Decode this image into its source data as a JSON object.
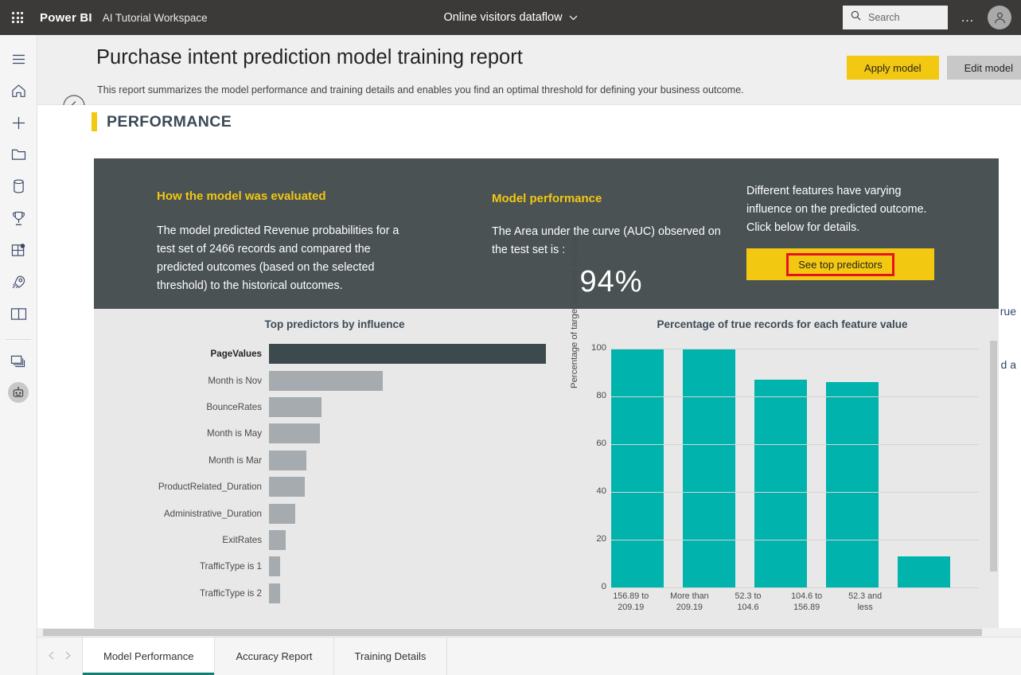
{
  "topbar": {
    "waffle_icon": "waffle-grid-icon",
    "brand": "Power BI",
    "workspace": "AI Tutorial Workspace",
    "document_title": "Online visitors dataflow",
    "caret_icon": "chevron-down-icon",
    "search_placeholder": "Search",
    "search_value": "",
    "search_icon": "search-icon",
    "more_icon": "ellipsis-icon",
    "avatar_icon": "user-avatar-icon"
  },
  "leftnav": {
    "items": [
      {
        "name": "hamburger-menu",
        "icon": "hamburger-icon"
      },
      {
        "name": "home",
        "icon": "home-icon"
      },
      {
        "name": "create",
        "icon": "plus-icon"
      },
      {
        "name": "browse",
        "icon": "folder-icon"
      },
      {
        "name": "data-hub",
        "icon": "database-icon"
      },
      {
        "name": "goals",
        "icon": "trophy-icon"
      },
      {
        "name": "apps",
        "icon": "apps-grid-icon"
      },
      {
        "name": "deployment-pipelines",
        "icon": "rocket-icon"
      },
      {
        "name": "learn",
        "icon": "book-icon"
      },
      {
        "name": "workspaces",
        "icon": "workspaces-icon"
      },
      {
        "name": "current-workspace",
        "icon": "robot-icon"
      }
    ]
  },
  "report_header": {
    "back_icon": "back-arrow-icon",
    "title": "Purchase intent prediction model training report",
    "subtitle": "This report summarizes the model performance and training details and enables you find an optimal threshold for defining your business outcome.",
    "apply_label": "Apply model",
    "edit_label": "Edit model"
  },
  "section": {
    "heading": "PERFORMANCE",
    "accent_color": "#f2c811"
  },
  "summary_panel": {
    "background": "#4a5254",
    "col1": {
      "heading": "How the model was evaluated",
      "body": "The model predicted Revenue probabilities for a test set of 2466 records and compared the predicted outcomes (based on the selected threshold) to the historical outcomes."
    },
    "col2": {
      "heading": "Model performance",
      "body": "The Area under the curve (AUC) observed on the test set is :",
      "auc_value": "94%"
    },
    "col3": {
      "body": "Different features have varying influence on the predicted outcome.  Click below for details.",
      "button_label": "See top predictors",
      "button_color": "#f2c811",
      "highlight_color": "#e81123"
    }
  },
  "chart_data": [
    {
      "type": "bar",
      "orientation": "horizontal",
      "title": "Top predictors by influence",
      "xlabel": "",
      "ylabel": "",
      "grid": false,
      "categories": [
        "PageValues",
        "Month is Nov",
        "BounceRates",
        "Month is May",
        "Month is Mar",
        "ProductRelated_Duration",
        "Administrative_Duration",
        "ExitRates",
        "TrafficType is 1",
        "TrafficType is 2"
      ],
      "values": [
        100,
        41,
        19,
        18.5,
        13.5,
        13,
        9.5,
        6,
        4,
        4
      ],
      "bar_colors": [
        "#3c4a4d",
        "#a5abaf",
        "#a5abaf",
        "#a5abaf",
        "#a5abaf",
        "#a5abaf",
        "#a5abaf",
        "#a5abaf",
        "#a5abaf",
        "#a5abaf"
      ],
      "highlighted_category": "PageValues"
    },
    {
      "type": "bar",
      "orientation": "vertical",
      "title": "Percentage of true records for each feature value",
      "xlabel": "",
      "ylabel": "Percentage of target outcome records",
      "grid": true,
      "legend": "none",
      "ylim": [
        0,
        100
      ],
      "yticks": [
        0,
        20,
        40,
        60,
        80,
        100
      ],
      "categories": [
        "156.89 to 209.19",
        "More than 209.19",
        "52.3 to 104.6",
        "104.6 to 156.89",
        "52.3 and less"
      ],
      "values": [
        100,
        100,
        87,
        86,
        13
      ],
      "bar_color": "#00b3ac"
    }
  ],
  "cut_text": {
    "line1": "rue",
    "line2": "d a"
  },
  "tabs": {
    "prev_icon": "chevron-left-icon",
    "next_icon": "chevron-right-icon",
    "items": [
      {
        "label": "Model Performance",
        "active": true
      },
      {
        "label": "Accuracy Report",
        "active": false
      },
      {
        "label": "Training Details",
        "active": false
      }
    ],
    "active_underline_color": "#137d6e"
  }
}
